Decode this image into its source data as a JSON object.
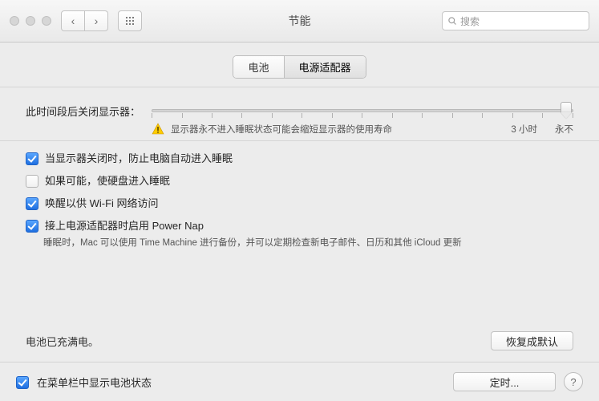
{
  "window": {
    "title": "节能"
  },
  "toolbar": {
    "search_placeholder": "搜索"
  },
  "tabs": {
    "battery": "电池",
    "adapter": "电源适配器",
    "active": "adapter"
  },
  "slider": {
    "label": "此时间段后关闭显示器：",
    "warning": "显示器永不进入睡眠状态可能会缩短显示器的使用寿命",
    "mark_left": "3 小时",
    "mark_right": "永不"
  },
  "options": {
    "prevent_sleep": {
      "checked": true,
      "label": "当显示器关闭时，防止电脑自动进入睡眠"
    },
    "disk_sleep": {
      "checked": false,
      "label": "如果可能，使硬盘进入睡眠"
    },
    "wake_wifi": {
      "checked": true,
      "label": "唤醒以供 Wi-Fi 网络访问"
    },
    "power_nap": {
      "checked": true,
      "label": "接上电源适配器时启用 Power Nap",
      "sub": "睡眠时，Mac 可以使用 Time Machine 进行备份，并可以定期检查新电子邮件、日历和其他 iCloud 更新"
    }
  },
  "status_text": "电池已充满电。",
  "buttons": {
    "restore_defaults": "恢复成默认",
    "schedule": "定时..."
  },
  "footer_checkbox": {
    "checked": true,
    "label": "在菜单栏中显示电池状态"
  }
}
